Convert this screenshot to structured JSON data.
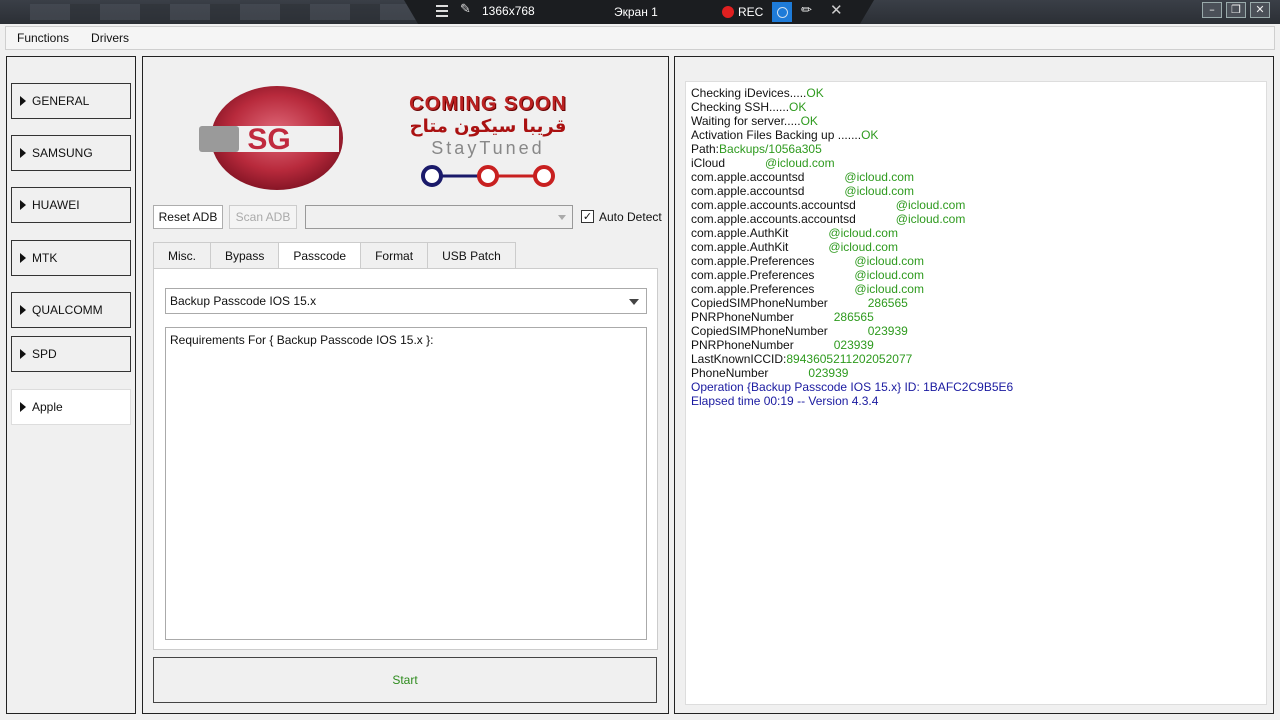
{
  "recorder": {
    "resolution": "1366x768",
    "screen": "Экран 1",
    "rec_label": "REC"
  },
  "menu": {
    "items": [
      "Functions",
      "Drivers"
    ]
  },
  "categories": [
    "GENERAL",
    "SAMSUNG",
    "HUAWEI",
    "MTK",
    "QUALCOMM",
    "SPD",
    "Apple"
  ],
  "banner": {
    "logo_text": "SG",
    "coming_soon": "COMING SOON",
    "arabic": "قريبا سيكون متاح",
    "stay_tuned": "StayTuned"
  },
  "toolbar": {
    "reset_adb": "Reset ADB",
    "scan_adb": "Scan ADB",
    "auto_detect": "Auto Detect"
  },
  "tabs": [
    "Misc.",
    "Bypass",
    "Passcode",
    "Format",
    "USB Patch"
  ],
  "passcode": {
    "selected_operation": "Backup Passcode IOS 15.x",
    "requirements": "Requirements For { Backup Passcode IOS 15.x }:"
  },
  "start_label": "Start",
  "log": [
    {
      "k": "Checking iDevices.....",
      "v": "OK",
      "c": "g"
    },
    {
      "k": "Checking SSH......",
      "v": "OK",
      "c": "g"
    },
    {
      "k": "Waiting for server.....",
      "v": "OK",
      "c": "g"
    },
    {
      "k": "Activation Files Backing up .......",
      "v": "OK",
      "c": "g"
    },
    {
      "k": "Path:",
      "v": "Backups/1056a305",
      "c": "g"
    },
    {
      "k": "iCloud            ",
      "v": "@icloud.com",
      "c": "g"
    },
    {
      "k": "com.apple.accountsd            ",
      "v": "@icloud.com",
      "c": "g"
    },
    {
      "k": "com.apple.accountsd            ",
      "v": "@icloud.com",
      "c": "g"
    },
    {
      "k": "com.apple.accounts.accountsd            ",
      "v": "@icloud.com",
      "c": "g"
    },
    {
      "k": "com.apple.accounts.accountsd            ",
      "v": "@icloud.com",
      "c": "g"
    },
    {
      "k": "com.apple.AuthKit            ",
      "v": "@icloud.com",
      "c": "g"
    },
    {
      "k": "com.apple.AuthKit            ",
      "v": "@icloud.com",
      "c": "g"
    },
    {
      "k": "com.apple.Preferences            ",
      "v": "@icloud.com",
      "c": "g"
    },
    {
      "k": "com.apple.Preferences            ",
      "v": "@icloud.com",
      "c": "g"
    },
    {
      "k": "com.apple.Preferences            ",
      "v": "@icloud.com",
      "c": "g"
    },
    {
      "k": "CopiedSIMPhoneNumber            ",
      "v": "286565",
      "c": "g"
    },
    {
      "k": "PNRPhoneNumber            ",
      "v": "286565",
      "c": "g"
    },
    {
      "k": "CopiedSIMPhoneNumber            ",
      "v": "023939",
      "c": "g"
    },
    {
      "k": "PNRPhoneNumber            ",
      "v": "023939",
      "c": "g"
    },
    {
      "k": "LastKnownICCID:",
      "v": "89436052112020520​77",
      "c": "g"
    },
    {
      "k": "PhoneNumber            ",
      "v": "023939",
      "c": "g"
    },
    {
      "k": "Operation {Backup Passcode IOS 15.x} ID: 1BAFC2C9B5E6",
      "v": "",
      "c": "b"
    },
    {
      "k": "Elapsed time 00:19 -- Version 4.3.4",
      "v": "",
      "c": "b"
    }
  ]
}
